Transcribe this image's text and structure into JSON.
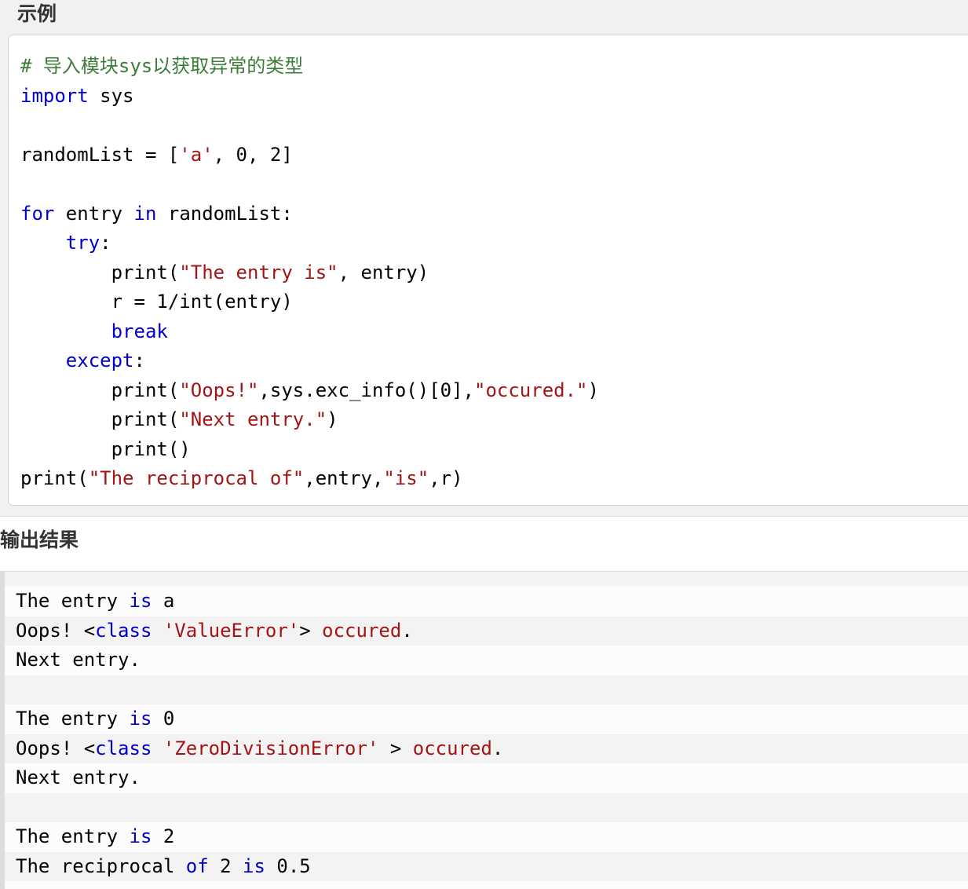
{
  "example": {
    "heading": "示例",
    "code_lines": [
      [
        {
          "com": "# 导入模块sys以获取异常的类型"
        }
      ],
      [
        {
          "kw": "import"
        },
        {
          "p": " sys"
        }
      ],
      [],
      [
        {
          "p": "randomList = ["
        },
        {
          "str": "'a'"
        },
        {
          "p": ", 0, 2]"
        }
      ],
      [],
      [
        {
          "kw": "for"
        },
        {
          "p": " entry "
        },
        {
          "kw": "in"
        },
        {
          "p": " randomList:"
        }
      ],
      [
        {
          "p": "    "
        },
        {
          "kw": "try"
        },
        {
          "p": ":"
        }
      ],
      [
        {
          "p": "        print("
        },
        {
          "str": "\"The entry is\""
        },
        {
          "p": ", entry)"
        }
      ],
      [
        {
          "p": "        r = 1/int(entry)"
        }
      ],
      [
        {
          "p": "        "
        },
        {
          "kw": "break"
        }
      ],
      [
        {
          "p": "    "
        },
        {
          "kw": "except"
        },
        {
          "p": ":"
        }
      ],
      [
        {
          "p": "        print("
        },
        {
          "str": "\"Oops!\""
        },
        {
          "p": ",sys.exc_info()[0],"
        },
        {
          "str": "\"occured.\""
        },
        {
          "p": ")"
        }
      ],
      [
        {
          "p": "        print("
        },
        {
          "str": "\"Next entry.\""
        },
        {
          "p": ")"
        }
      ],
      [
        {
          "p": "        print()"
        }
      ],
      [
        {
          "p": "print("
        },
        {
          "str": "\"The reciprocal of\""
        },
        {
          "p": ",entry,"
        },
        {
          "str": "\"is\""
        },
        {
          "p": ",r)"
        }
      ]
    ]
  },
  "output": {
    "heading": "输出结果",
    "lines": [
      [
        {
          "p": "The entry "
        },
        {
          "kw": "is"
        },
        {
          "p": " a"
        }
      ],
      [
        {
          "p": "Oops! <"
        },
        {
          "kw": "class"
        },
        {
          "p": " "
        },
        {
          "str": "'ValueError'"
        },
        {
          "p": "> "
        },
        {
          "str": "occured"
        },
        {
          "p": "."
        }
      ],
      [
        {
          "p": "Next entry."
        }
      ],
      [],
      [
        {
          "p": "The entry "
        },
        {
          "kw": "is"
        },
        {
          "p": " 0"
        }
      ],
      [
        {
          "p": "Oops! <"
        },
        {
          "kw": "class"
        },
        {
          "p": " "
        },
        {
          "str": "'ZeroDivisionError'"
        },
        {
          "p": " > "
        },
        {
          "str": "occured"
        },
        {
          "p": "."
        }
      ],
      [
        {
          "p": "Next entry."
        }
      ],
      [],
      [
        {
          "p": "The entry "
        },
        {
          "kw": "is"
        },
        {
          "p": " 2"
        }
      ],
      [
        {
          "p": "The reciprocal "
        },
        {
          "kw": "of"
        },
        {
          "p": " 2 "
        },
        {
          "kw": "is"
        },
        {
          "p": " 0.5"
        }
      ]
    ]
  },
  "syntax_colors": {
    "kw": "#0000cc",
    "str": "#a31515",
    "com": "#3c7d3c",
    "p": "#000000"
  }
}
